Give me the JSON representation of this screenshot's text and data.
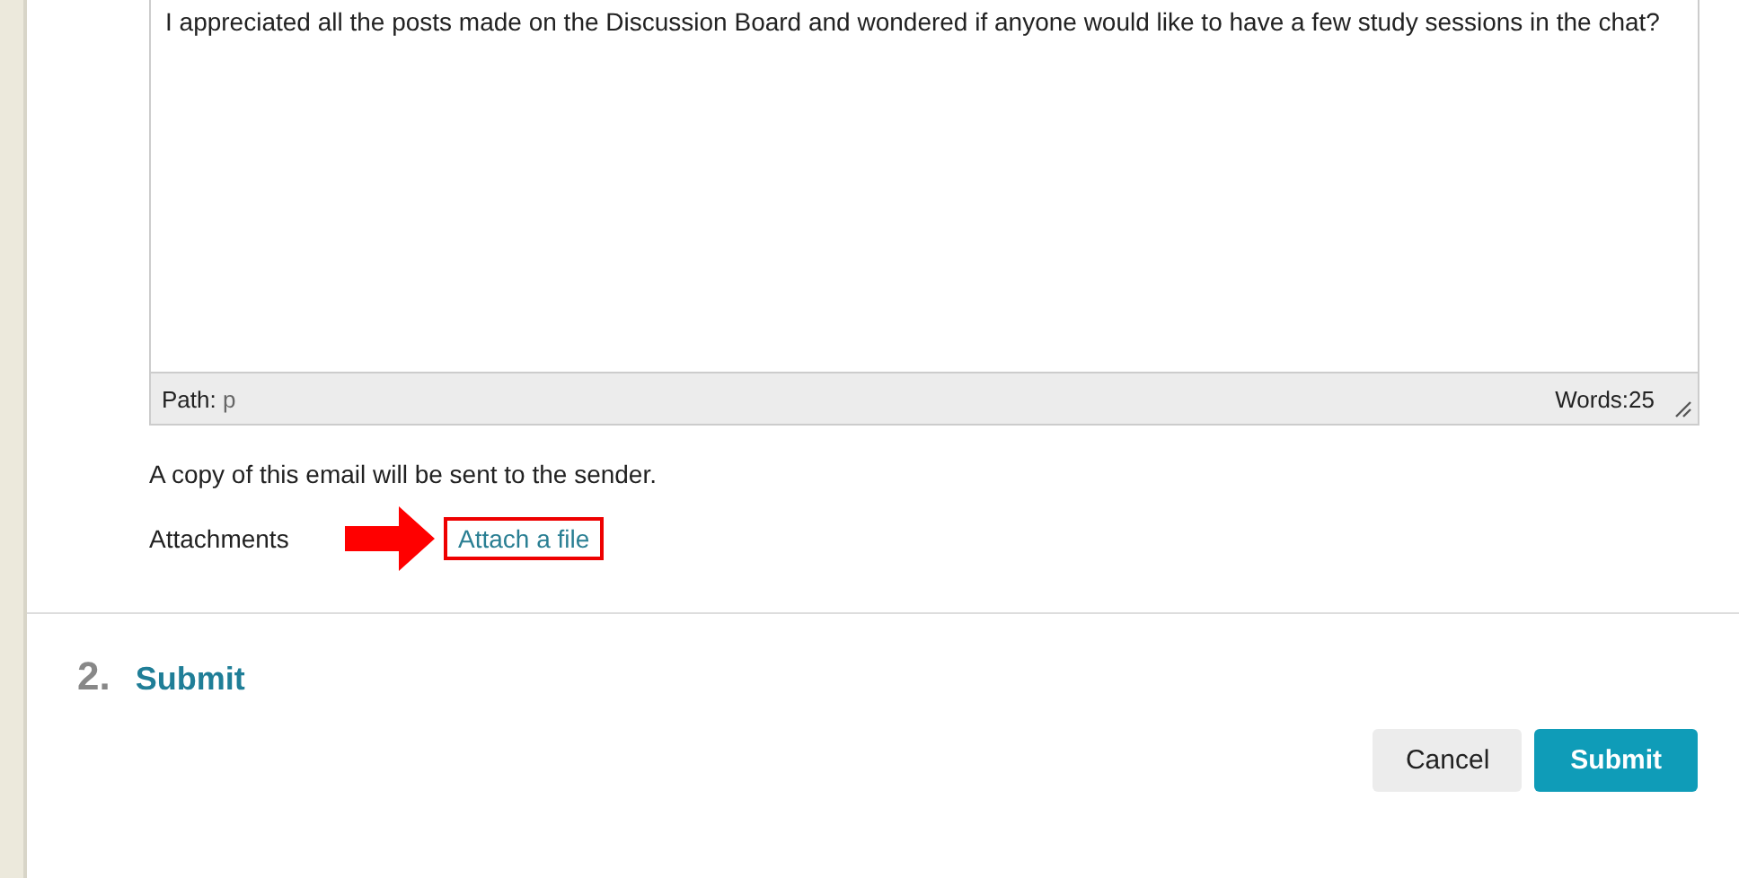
{
  "editor": {
    "body": "I appreciated all the posts made on the Discussion Board and wondered if anyone would like to have a few study sessions in the chat?",
    "path_label": "Path:",
    "path_value": "p",
    "word_count": "Words:25"
  },
  "copy_notice": "A copy of this email will be sent to the sender.",
  "attachments": {
    "label": "Attachments",
    "link": "Attach a file",
    "highlighted": true
  },
  "step": {
    "number": "2.",
    "title": "Submit"
  },
  "buttons": [
    {
      "label": "Cancel",
      "kind": "secondary"
    },
    {
      "label": "Submit",
      "kind": "primary"
    }
  ]
}
